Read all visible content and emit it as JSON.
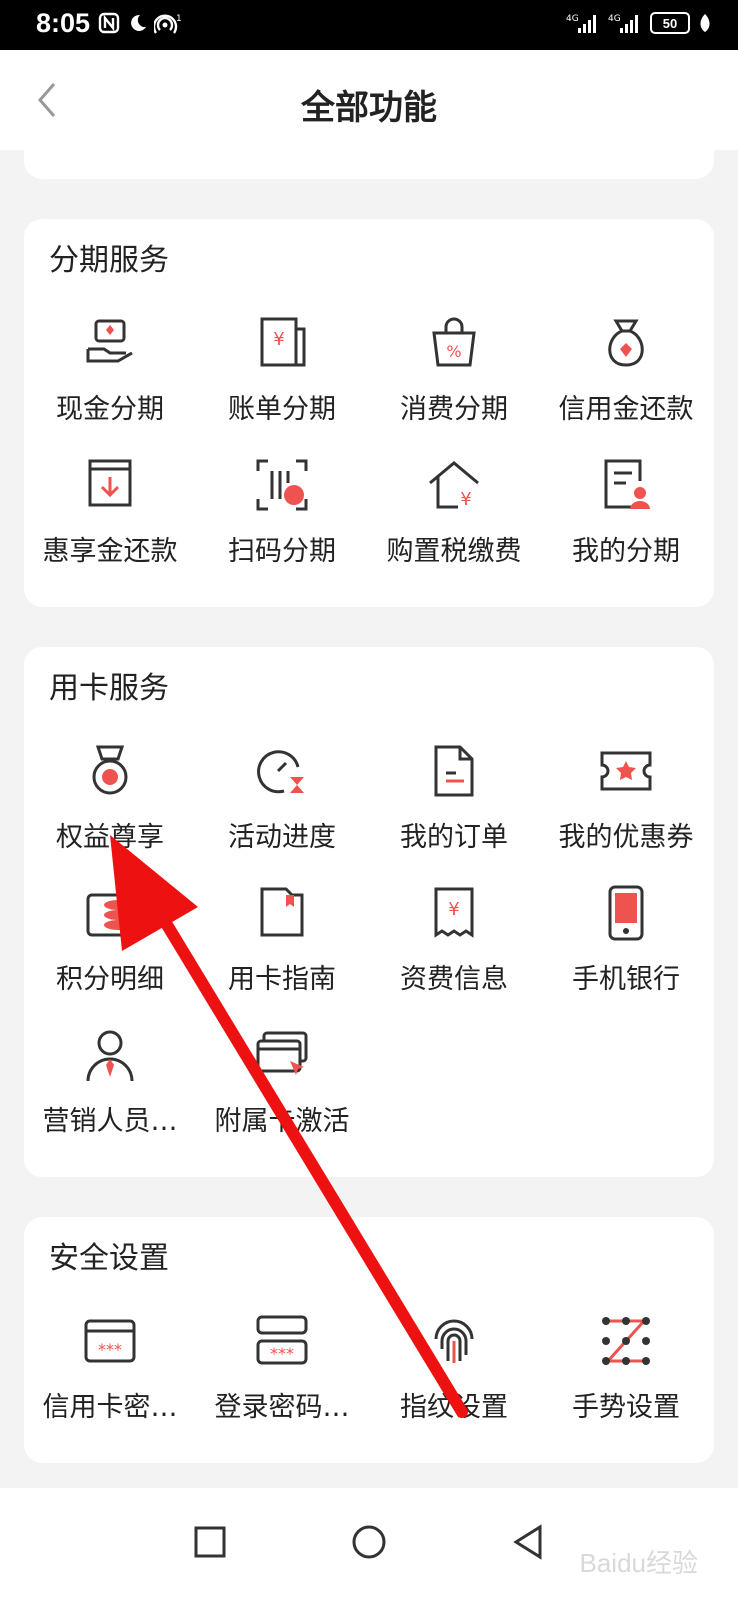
{
  "status": {
    "time": "8:05",
    "battery": "50",
    "signal1": "4G",
    "signal2": "4G"
  },
  "header": {
    "title": "全部功能"
  },
  "sections": [
    {
      "title": "分期服务",
      "items": [
        {
          "label": "现金分期",
          "icon": "cash-hand-icon"
        },
        {
          "label": "账单分期",
          "icon": "bill-yuan-icon"
        },
        {
          "label": "消费分期",
          "icon": "shopping-bag-icon"
        },
        {
          "label": "信用金还款",
          "icon": "money-bag-icon"
        },
        {
          "label": "惠享金还款",
          "icon": "download-box-icon"
        },
        {
          "label": "扫码分期",
          "icon": "scan-code-icon"
        },
        {
          "label": "购置税缴费",
          "icon": "house-yuan-icon"
        },
        {
          "label": "我的分期",
          "icon": "document-person-icon"
        }
      ]
    },
    {
      "title": "用卡服务",
      "items": [
        {
          "label": "权益尊享",
          "icon": "medal-icon"
        },
        {
          "label": "活动进度",
          "icon": "timer-icon"
        },
        {
          "label": "我的订单",
          "icon": "order-document-icon"
        },
        {
          "label": "我的优惠券",
          "icon": "coupon-star-icon"
        },
        {
          "label": "积分明细",
          "icon": "points-coins-icon"
        },
        {
          "label": "用卡指南",
          "icon": "guide-book-icon"
        },
        {
          "label": "资费信息",
          "icon": "fee-receipt-icon"
        },
        {
          "label": "手机银行",
          "icon": "mobile-phone-icon"
        },
        {
          "label": "营销人员…",
          "icon": "salesperson-icon"
        },
        {
          "label": "附属卡激活",
          "icon": "card-activate-icon"
        }
      ]
    },
    {
      "title": "安全设置",
      "items": [
        {
          "label": "信用卡密…",
          "icon": "card-password-icon"
        },
        {
          "label": "登录密码…",
          "icon": "login-password-icon"
        },
        {
          "label": "指纹设置",
          "icon": "fingerprint-icon"
        },
        {
          "label": "手势设置",
          "icon": "gesture-pattern-icon"
        }
      ]
    }
  ],
  "watermark": "Baidu经验",
  "colors": {
    "accent": "#ef5350",
    "text": "#222222",
    "background": "#f3f3f3",
    "arrow": "#ee1111"
  }
}
